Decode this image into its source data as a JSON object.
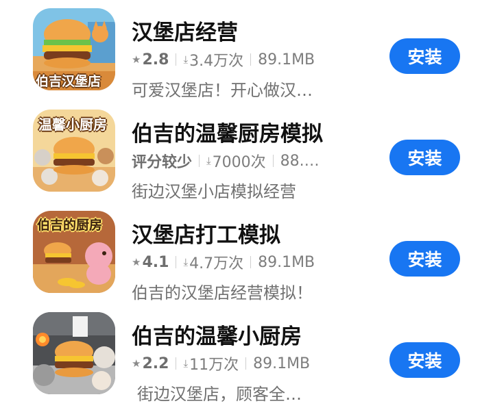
{
  "apps": [
    {
      "title": "汉堡店经营",
      "rating": "2.8",
      "downloads": "3.4万次",
      "size": "89.1MB",
      "description": "可爱汉堡店！开心做汉…",
      "install_label": "安装",
      "icon_text": "伯吉汉堡店"
    },
    {
      "title": "伯吉的温馨厨房模拟",
      "rating": "评分较少",
      "downloads": "7000次",
      "size": "88.…",
      "description": "街边汉堡小店模拟经营",
      "install_label": "安装",
      "icon_text": "温馨小厨房"
    },
    {
      "title": "汉堡店打工模拟",
      "rating": "4.1",
      "downloads": "4.7万次",
      "size": "89.1MB",
      "description": "伯吉的汉堡店经营模拟！",
      "install_label": "安装",
      "icon_text": "伯吉的厨房"
    },
    {
      "title": "伯吉的温馨小厨房",
      "rating": "2.2",
      "downloads": "11万次",
      "size": "89.1MB",
      "description": "街边汉堡店，顾客全…",
      "install_label": "安装",
      "icon_text": ""
    }
  ],
  "colors": {
    "install_button": "#1876f2",
    "title_text": "#111111",
    "meta_text": "#7d7d7d"
  },
  "icons": {
    "star": "star-icon",
    "download": "download-icon"
  }
}
